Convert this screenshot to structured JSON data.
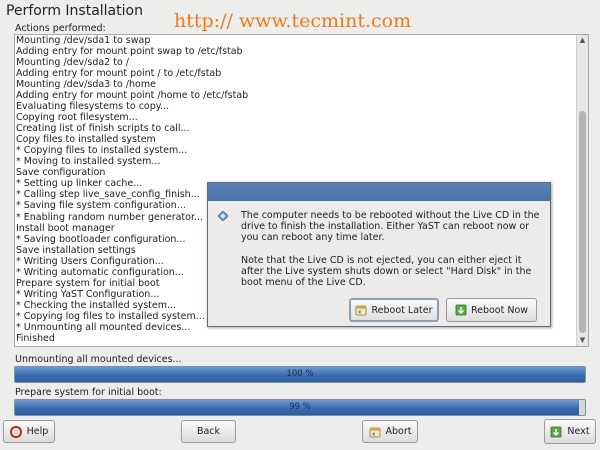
{
  "window": {
    "title": "Perform Installation"
  },
  "watermark": "http:// www.tecmint.com",
  "log": {
    "label": "Actions performed:",
    "lines": [
      "Mounting /dev/sda1 to swap",
      "Adding entry for mount point swap to /etc/fstab",
      "Mounting /dev/sda2 to /",
      "Adding entry for mount point / to /etc/fstab",
      "Mounting /dev/sda3 to /home",
      "Adding entry for mount point /home to /etc/fstab",
      "Evaluating filesystems to copy...",
      "Copying root filesystem...",
      "Creating list of finish scripts to call...",
      "Copy files to installed system",
      " * Copying files to installed system...",
      " * Moving to installed system...",
      "Save configuration",
      " * Setting up linker cache...",
      " * Calling step live_save_config_finish...",
      " * Saving file system configuration...",
      " * Enabling random number generator...",
      "Install boot manager",
      " * Saving bootloader configuration...",
      "Save installation settings",
      " * Writing Users Configuration...",
      " * Writing automatic configuration...",
      "Prepare system for initial boot",
      " * Writing YaST Configuration...",
      " * Checking the installed system...",
      " * Copying log files to installed system...",
      " * Unmounting all mounted devices...",
      "Finished"
    ]
  },
  "dialog": {
    "message_1": "The computer needs to be rebooted without the Live CD in the drive to finish the installation. Either YaST can reboot now or you can reboot any time later.",
    "message_2": "Note that the Live CD is not ejected, you can either eject it after the Live system shuts down or select \"Hard Disk\" in the boot menu of the Live CD.",
    "reboot_later_label": "Reboot Later",
    "reboot_now_label": "Reboot Now"
  },
  "progress": [
    {
      "label": "Unmounting all mounted devices...",
      "value_text": "100 %",
      "fraction": 1.0
    },
    {
      "label": "Prepare system for initial boot:",
      "value_text": "99 %",
      "fraction": 0.99
    }
  ],
  "footer": {
    "help_label": "Help",
    "back_label": "Back",
    "abort_label": "Abort",
    "next_label": "Next"
  },
  "colors": {
    "accent": "#3b6db0",
    "watermark": "#f07a1a",
    "dialog_titlebar": "#4a72a6"
  }
}
